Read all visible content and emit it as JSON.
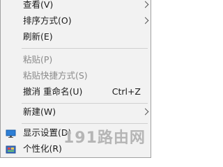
{
  "menu": {
    "items": [
      {
        "label": "查看(V)"
      },
      {
        "label": "排序方式(O)"
      },
      {
        "label": "刷新(E)"
      },
      {
        "label": "粘贴(P)"
      },
      {
        "label": "粘贴快捷方式(S)"
      },
      {
        "label": "撤消 重命名(U)",
        "shortcut": "Ctrl+Z"
      },
      {
        "label": "新建(W)"
      },
      {
        "label": "显示设置(D)"
      },
      {
        "label": "个性化(R)"
      }
    ]
  },
  "watermark": "191路由网",
  "icons": {
    "display_settings": "monitor-icon",
    "personalize": "personalize-icon",
    "submenu": "chevron-right-icon"
  },
  "colors": {
    "menu_bg": "#f2f2f2",
    "disabled_text": "#8a8a8a",
    "separator": "#d0d0d0"
  }
}
